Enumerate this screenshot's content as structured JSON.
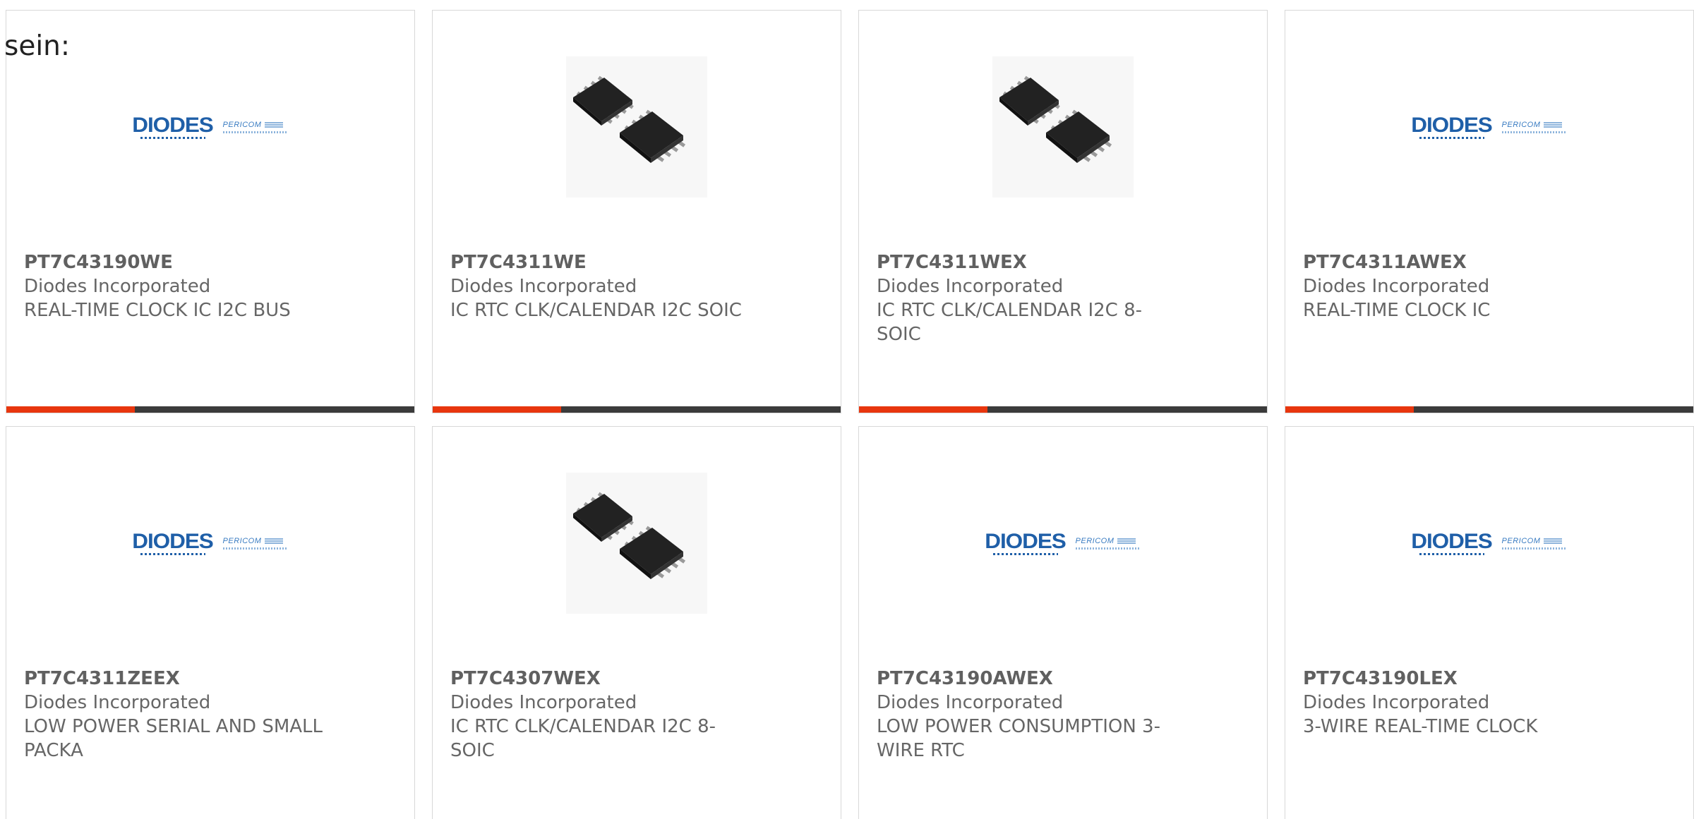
{
  "lead_text": "sein:",
  "logo": {
    "wordmark": "DIODES",
    "partner": "PERICOM"
  },
  "colors": {
    "accent": "#e8360e",
    "bar": "#3b3b3b",
    "logo_blue": "#1f5fa8"
  },
  "cards": [
    {
      "part": "PT7C43190WE",
      "maker": "Diodes Incorporated",
      "desc": "REAL-TIME CLOCK IC I2C BUS",
      "image": "diodes-logo"
    },
    {
      "part": "PT7C4311WE",
      "maker": "Diodes Incorporated",
      "desc": "IC RTC CLK/CALENDAR I2C SOIC",
      "image": "soic-chip-photo"
    },
    {
      "part": "PT7C4311WEX",
      "maker": "Diodes Incorporated",
      "desc": "IC RTC CLK/CALENDAR I2C 8-SOIC",
      "image": "soic-chip-photo"
    },
    {
      "part": "PT7C4311AWEX",
      "maker": "Diodes Incorporated",
      "desc": "REAL-TIME CLOCK IC",
      "image": "diodes-logo"
    },
    {
      "part": "PT7C4311ZEEX",
      "maker": "Diodes Incorporated",
      "desc": "LOW POWER SERIAL AND SMALL PACKA",
      "image": "diodes-logo"
    },
    {
      "part": "PT7C4307WEX",
      "maker": "Diodes Incorporated",
      "desc": "IC RTC CLK/CALENDAR I2C 8-SOIC",
      "image": "soic-chip-photo"
    },
    {
      "part": "PT7C43190AWEX",
      "maker": "Diodes Incorporated",
      "desc": "LOW POWER CONSUMPTION 3-WIRE RTC",
      "image": "diodes-logo"
    },
    {
      "part": "PT7C43190LEX",
      "maker": "Diodes Incorporated",
      "desc": "3-WIRE REAL-TIME CLOCK",
      "image": "diodes-logo"
    }
  ]
}
